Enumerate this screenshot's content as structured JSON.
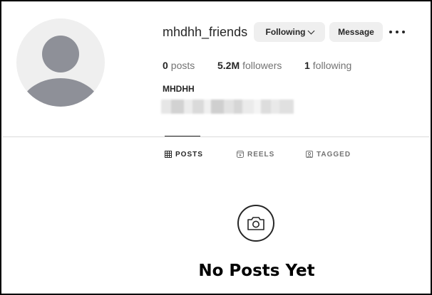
{
  "profile": {
    "username": "mhdhh_friends",
    "full_name": "MHDHH",
    "avatar_icon": "default-avatar-icon"
  },
  "actions": {
    "following_label": "Following",
    "message_label": "Message",
    "more_icon": "more-horizontal-icon"
  },
  "stats": {
    "posts": {
      "value": "0",
      "label": "posts"
    },
    "followers": {
      "value": "5.2M",
      "label": "followers"
    },
    "following": {
      "value": "1",
      "label": "following"
    }
  },
  "tabs": [
    {
      "label": "POSTS",
      "icon": "grid-icon",
      "active": true
    },
    {
      "label": "REELS",
      "icon": "reels-icon",
      "active": false
    },
    {
      "label": "TAGGED",
      "icon": "tagged-icon",
      "active": false
    }
  ],
  "empty_state": {
    "icon": "camera-icon",
    "title": "No Posts Yet"
  },
  "colors": {
    "text": "#262626",
    "muted": "#737373",
    "button_bg": "#efefef",
    "avatar_bg": "#efefef",
    "avatar_fg": "#8e9098",
    "divider": "#dbdbdb"
  }
}
